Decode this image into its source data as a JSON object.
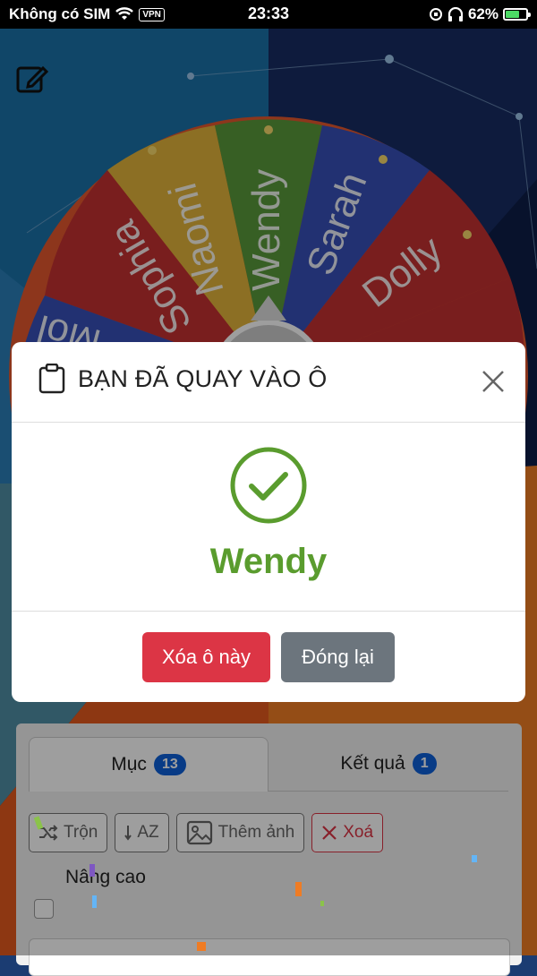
{
  "status_bar": {
    "carrier": "Không có SIM",
    "vpn": "VPN",
    "time": "23:33",
    "battery": "62%"
  },
  "wheel": {
    "segments": [
      "Sophia",
      "Naomi",
      "Wendy",
      "Sarah",
      "Dolly",
      "Mol"
    ]
  },
  "panel": {
    "tabs": [
      {
        "label": "Mục",
        "badge": "13"
      },
      {
        "label": "Kết quả",
        "badge": "1"
      }
    ],
    "toolbar": {
      "shuffle": "Trộn",
      "sort": "AZ",
      "add_image": "Thêm ảnh",
      "delete": "Xoá"
    },
    "advanced": "Nâng cao"
  },
  "modal": {
    "title": "BẠN ĐÃ QUAY VÀO Ô",
    "winner": "Wendy",
    "remove_button": "Xóa ô này",
    "close_button": "Đóng lại"
  },
  "colors": {
    "success": "#5a9c2e",
    "danger": "#dc3545",
    "secondary": "#6c757d",
    "badge": "#0d5fd8"
  }
}
